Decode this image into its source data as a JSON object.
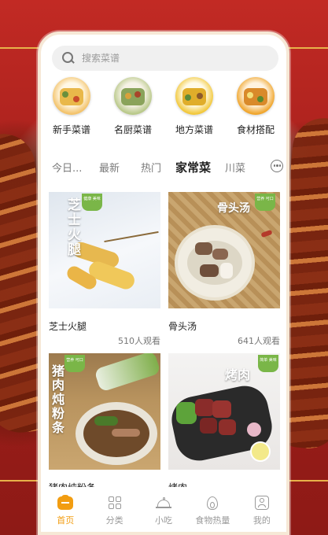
{
  "search": {
    "placeholder": "搜索菜谱"
  },
  "categories": [
    {
      "label": "新手菜谱",
      "icon": "beginner-recipes-icon"
    },
    {
      "label": "名厨菜谱",
      "icon": "chef-recipes-icon"
    },
    {
      "label": "地方菜谱",
      "icon": "regional-recipes-icon"
    },
    {
      "label": "食材搭配",
      "icon": "ingredient-pairing-icon"
    }
  ],
  "tabs": [
    {
      "label": "今日..."
    },
    {
      "label": "最新"
    },
    {
      "label": "热门"
    },
    {
      "label": "家常菜",
      "active": true
    },
    {
      "label": "川菜"
    }
  ],
  "recipes": [
    {
      "title": "芝士火腿",
      "views": "510人观看",
      "overlay": "芝士火腿",
      "badge": "健康 美味"
    },
    {
      "title": "骨头汤",
      "views": "641人观看",
      "overlay": "骨头汤",
      "badge": "营养 可口"
    },
    {
      "title": "猪肉炖粉条",
      "views": "",
      "overlay": "猪肉炖粉条",
      "badge": "营养 可口"
    },
    {
      "title": "烤肉",
      "views": "",
      "overlay": "烤肉",
      "badge": "简单 美味"
    }
  ],
  "nav": [
    {
      "label": "首页",
      "active": true
    },
    {
      "label": "分类"
    },
    {
      "label": "小吃"
    },
    {
      "label": "食物热量"
    },
    {
      "label": "我的"
    }
  ],
  "colors": {
    "accent": "#f29d11",
    "background_red": "#b8241f",
    "badge_green": "#7ab648"
  }
}
